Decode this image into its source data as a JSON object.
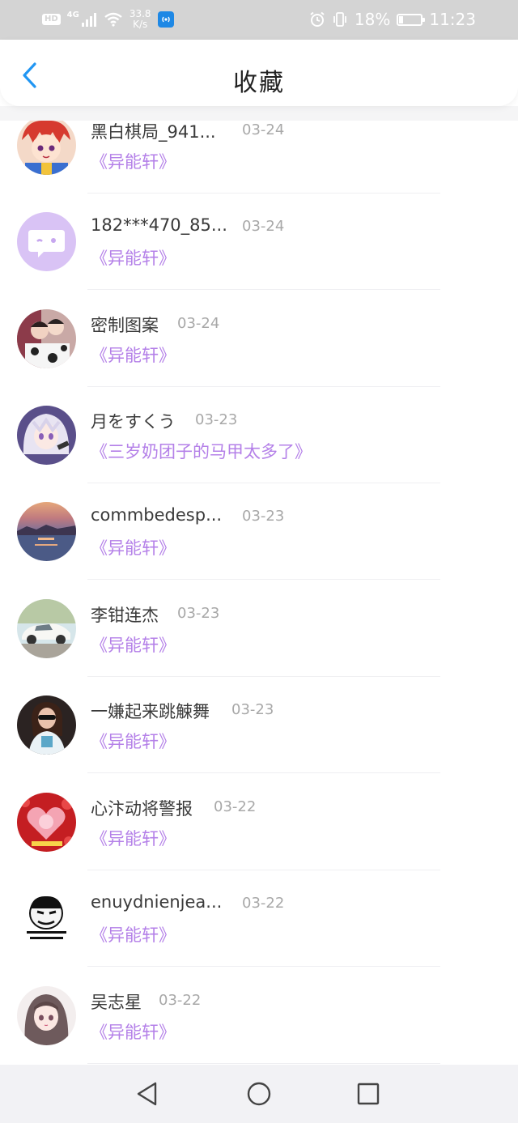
{
  "status_bar": {
    "hd": "HD",
    "network": "4G",
    "speed_value": "33.8",
    "speed_unit": "K/s",
    "battery": "18%",
    "time": "11:23",
    "icons": [
      "signal-icon",
      "wifi-icon",
      "hotspot-icon",
      "alarm-icon",
      "vibrate-icon",
      "battery-icon"
    ]
  },
  "header": {
    "title": "收藏",
    "back_icon": "chevron-left-icon",
    "accent": "#2196f3"
  },
  "colors": {
    "book_title": "#b480e8",
    "date": "#a8a8a8",
    "name": "#3a3a3a"
  },
  "favorites": [
    {
      "name": "黑白棋局_941...",
      "date": "03-24",
      "book": "《异能轩》",
      "avatar": "anime-boy-red-hair"
    },
    {
      "name": "182***470_85...",
      "date": "03-24",
      "book": "《异能轩》",
      "avatar": "default-chat-avatar"
    },
    {
      "name": "密制图案",
      "date": "03-24",
      "book": "《异能轩》",
      "avatar": "couple-photo"
    },
    {
      "name": "月をすくう",
      "date": "03-23",
      "book": "《三岁奶团子的马甲太多了》",
      "avatar": "anime-girl-white-hair"
    },
    {
      "name": "commbedesp...",
      "date": "03-23",
      "book": "《异能轩》",
      "avatar": "sunset-sea"
    },
    {
      "name": "李钳连杰",
      "date": "03-23",
      "book": "《异能轩》",
      "avatar": "white-sports-car"
    },
    {
      "name": "一嫌起来跳觫舞",
      "date": "03-23",
      "book": "《异能轩》",
      "avatar": "woman-photo"
    },
    {
      "name": "心汴动将警报",
      "date": "03-22",
      "book": "《异能轩》",
      "avatar": "red-heart-card"
    },
    {
      "name": "enuydnienjea...",
      "date": "03-22",
      "book": "《异能轩》",
      "avatar": "meme-face"
    },
    {
      "name": "吴志星",
      "date": "03-22",
      "book": "《异能轩》",
      "avatar": "anime-girl-dark-hair"
    }
  ],
  "nav_bar": {
    "back": "triangle-back-icon",
    "home": "circle-home-icon",
    "recents": "square-recents-icon"
  }
}
